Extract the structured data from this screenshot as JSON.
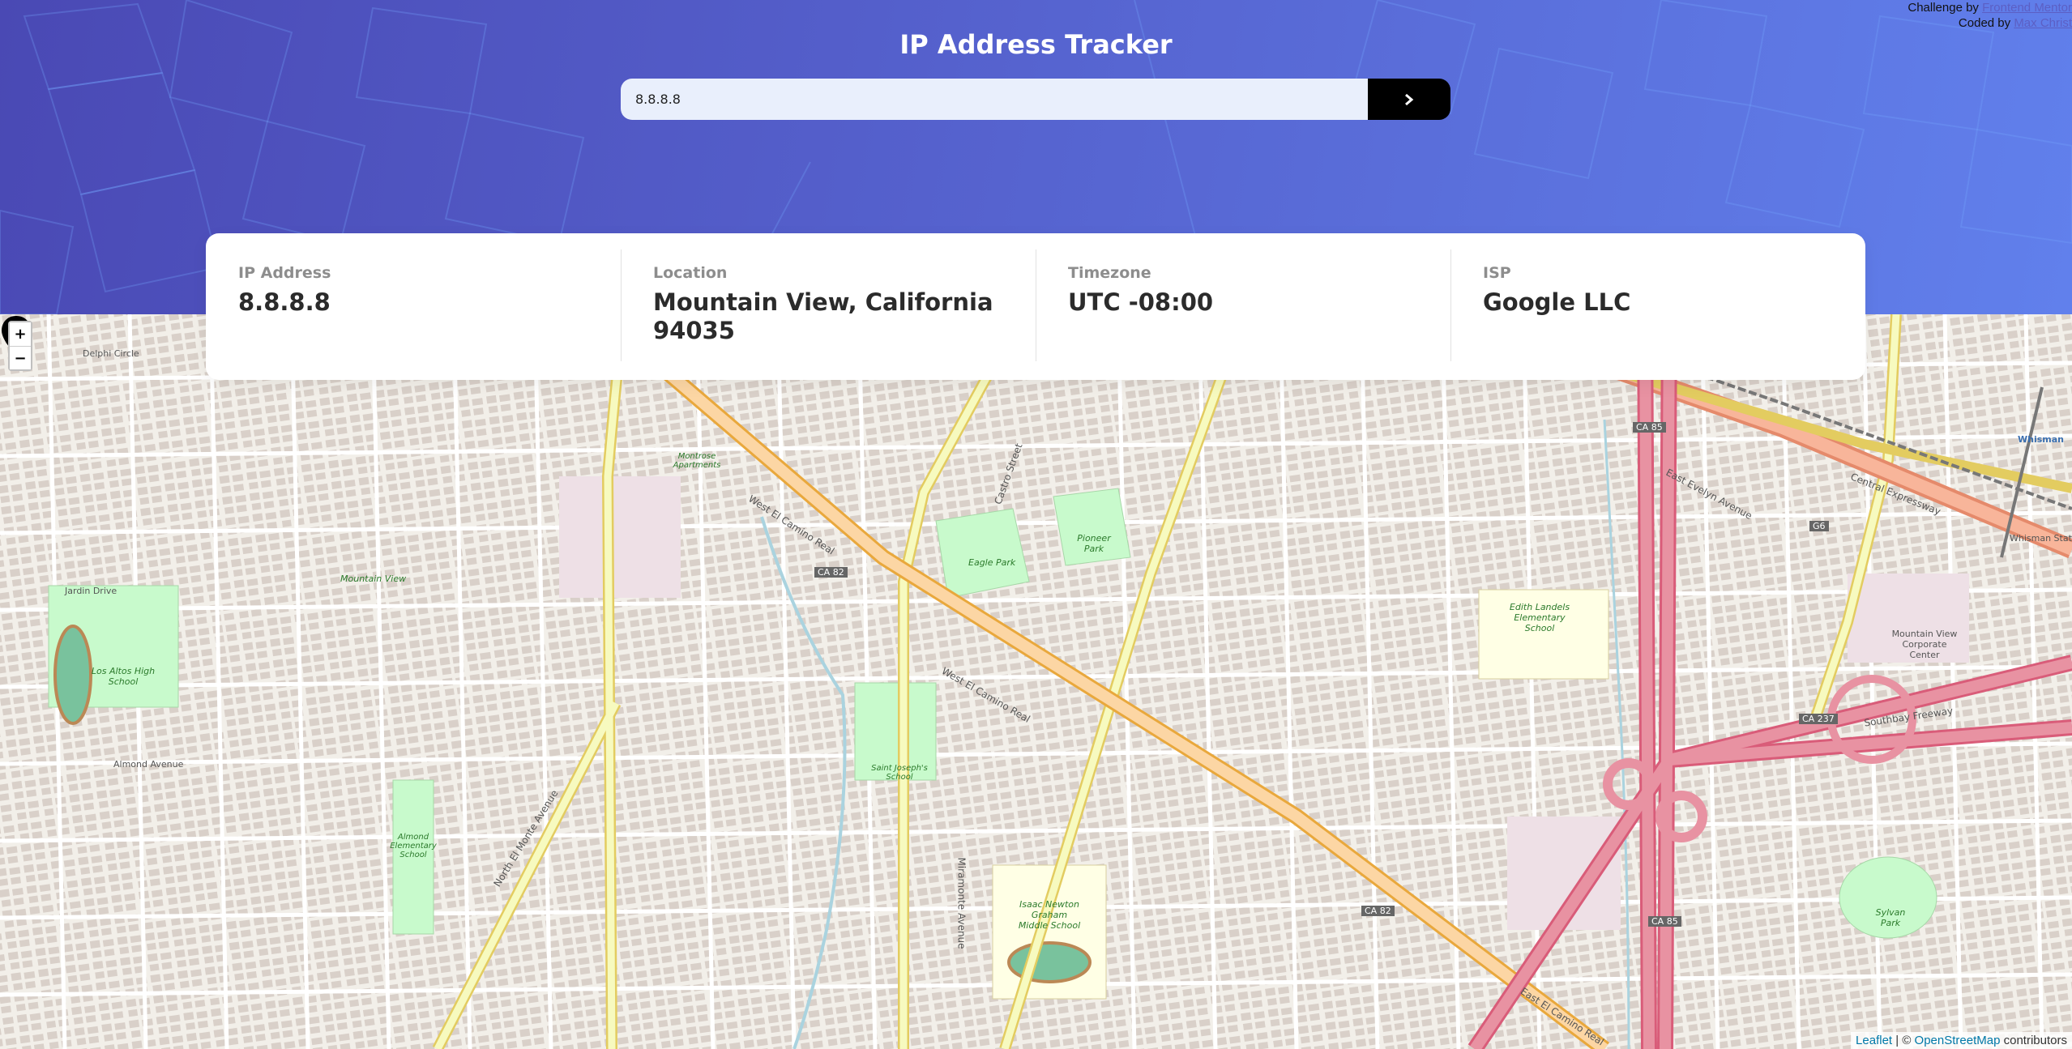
{
  "header": {
    "title": "IP Address Tracker",
    "challenge_prefix": "Challenge by",
    "challenge_link": "Frontend Mentor",
    "coded_prefix": "Coded by",
    "coded_link": "Max Christ"
  },
  "search": {
    "value": "8.8.8.8",
    "submit_icon": "chevron-right-icon"
  },
  "info": {
    "ip_label": "IP Address",
    "ip_value": "8.8.8.8",
    "location_label": "Location",
    "location_value": "Mountain View, California 94035",
    "timezone_label": "Timezone",
    "timezone_value": "UTC -08:00",
    "isp_label": "ISP",
    "isp_value": "Google LLC"
  },
  "map": {
    "zoom_in": "+",
    "zoom_out": "−",
    "attribution": {
      "leaflet": "Leaflet",
      "separator": " | © ",
      "osm": "OpenStreetMap",
      "suffix": " contributors"
    },
    "labels": {
      "el_camino": "West El Camino Real",
      "el_camino_2": "West El Camino Real",
      "el_camino_3": "East El Camino Real",
      "ca82": "CA 82",
      "ca82_b": "CA 82",
      "ca85": "CA 85",
      "ca85_b": "CA 85",
      "ca237": "CA 237",
      "g6": "G6",
      "central_expressway": "Central Expressway",
      "east_evelyn": "East Evelyn Avenue",
      "southbay": "Southbay Freeway",
      "eagle_park": "Eagle Park",
      "pioneer_park": "Pioneer Park",
      "los_altos_hs": "Los Altos High School",
      "almond_school": "Almond Elementary School",
      "saint_josephs": "Saint Joseph's School",
      "isaac_newton": "Isaac Newton Graham Middle School",
      "edith_landels": "Edith Landels Elementary School",
      "mountain_view_center": "Mountain View Corporate Center",
      "whisman": "Whisman",
      "whisman_station": "Whisman Station",
      "sylvan_park": "Sylvan Park",
      "mountain_view": "Mountain View",
      "delphi": "Delphi Circle",
      "jardin": "Jardin Drive",
      "almond_ave": "Almond Avenue",
      "castro": "Castro Street",
      "miramonte": "Miramonte Avenue",
      "north_el_monte": "North El Monte Avenue",
      "montrose": "Montrose Apartments"
    }
  }
}
